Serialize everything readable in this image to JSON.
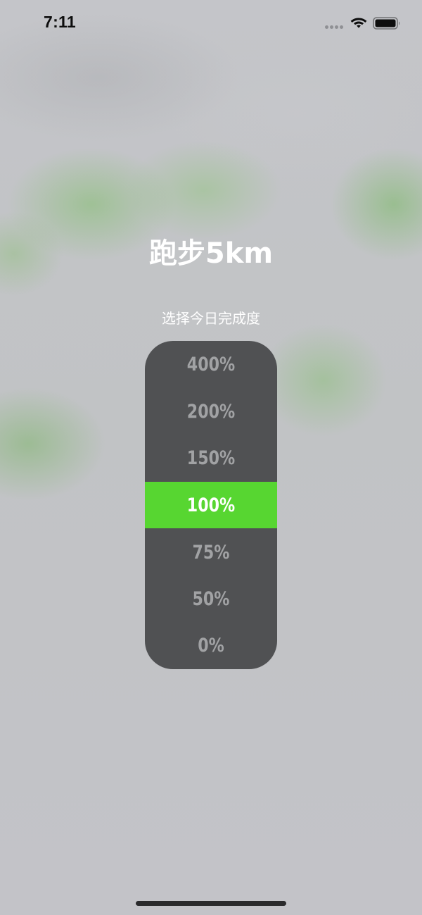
{
  "status_bar": {
    "time": "7:11",
    "icons": [
      "signal-dots-icon",
      "wifi-icon",
      "battery-icon"
    ]
  },
  "screen": {
    "title": "跑步5km",
    "subtitle": "选择今日完成度"
  },
  "picker": {
    "options": [
      "400%",
      "200%",
      "150%",
      "100%",
      "75%",
      "50%",
      "0%"
    ],
    "selected_index": 3,
    "selected_value": "100%"
  },
  "colors": {
    "picker_background": "#505153",
    "highlight": "#57d631",
    "option_text": "#a1a2a4",
    "selected_text": "#ffffff",
    "title_text": "#ffffff"
  }
}
